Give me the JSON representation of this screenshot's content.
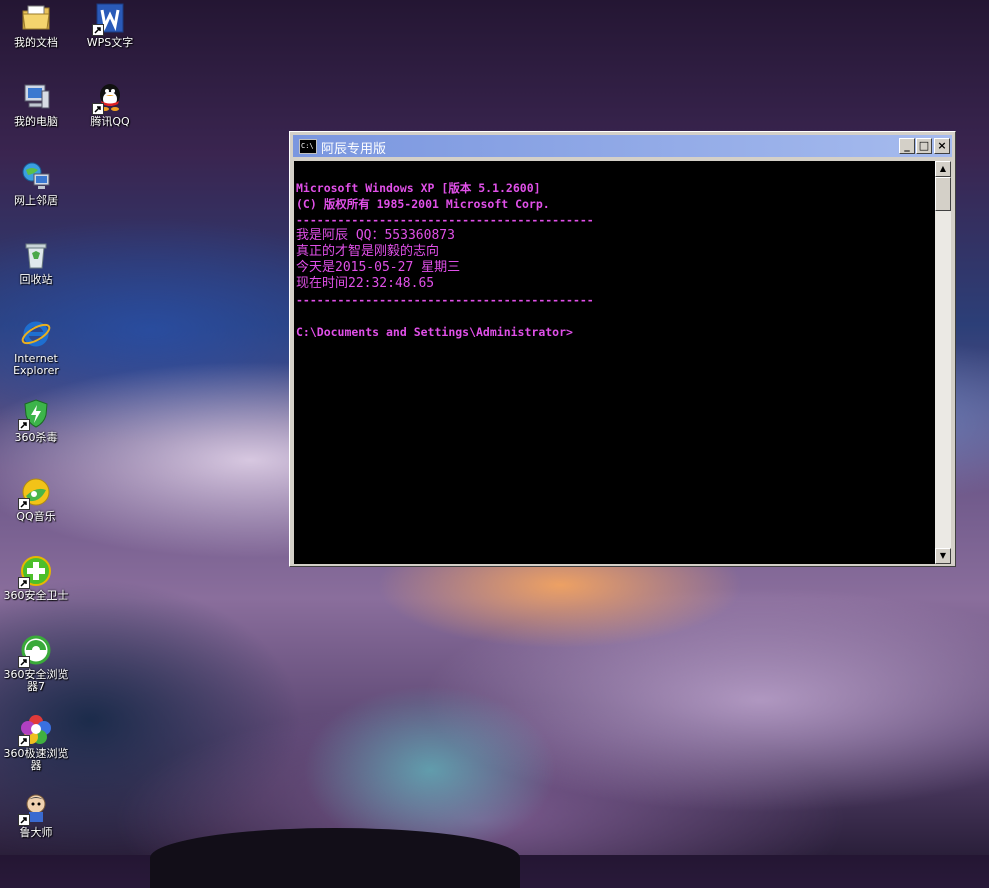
{
  "desktop": {
    "icons": [
      {
        "label": "我的文档",
        "icon": "my-documents-icon"
      },
      {
        "label": "我的电脑",
        "icon": "my-computer-icon"
      },
      {
        "label": "网上邻居",
        "icon": "network-places-icon"
      },
      {
        "label": "回收站",
        "icon": "recycle-bin-icon"
      },
      {
        "label": "Internet\nExplorer",
        "icon": "internet-explorer-icon"
      },
      {
        "label": "360杀毒",
        "icon": "360-antivirus-icon"
      },
      {
        "label": "QQ音乐",
        "icon": "qq-music-icon"
      },
      {
        "label": "360安全卫士",
        "icon": "360-safeguard-icon"
      },
      {
        "label": "360安全浏览器7",
        "icon": "360-secure-browser-icon"
      },
      {
        "label": "360极速浏览器",
        "icon": "360-speed-browser-icon"
      },
      {
        "label": "鲁大师",
        "icon": "ludashi-icon"
      },
      {
        "label": "WPS文字",
        "icon": "wps-writer-icon"
      },
      {
        "label": "腾讯QQ",
        "icon": "tencent-qq-icon"
      }
    ]
  },
  "window": {
    "title": "阿辰专用版",
    "icon_text": "C:\\",
    "min_label": "_",
    "max_label": "□",
    "close_label": "×"
  },
  "console": {
    "lines": [
      "Microsoft Windows XP [版本 5.1.2600]",
      "(C) 版权所有 1985-2001 Microsoft Corp.",
      "-------------------------------------------",
      "我是阿辰 QQ：553360873",
      "真正的才智是刚毅的志向",
      "今天是2015-05-27 星期三",
      "现在时间22:32:48.65",
      "-------------------------------------------",
      "",
      "C:\\Documents and Settings\\Administrator>"
    ]
  },
  "scrollbar": {
    "up_label": "▲",
    "down_label": "▼"
  },
  "colors": {
    "console_text": "#e050e8",
    "console_bg": "#000000",
    "titlebar": "#7a96df"
  }
}
